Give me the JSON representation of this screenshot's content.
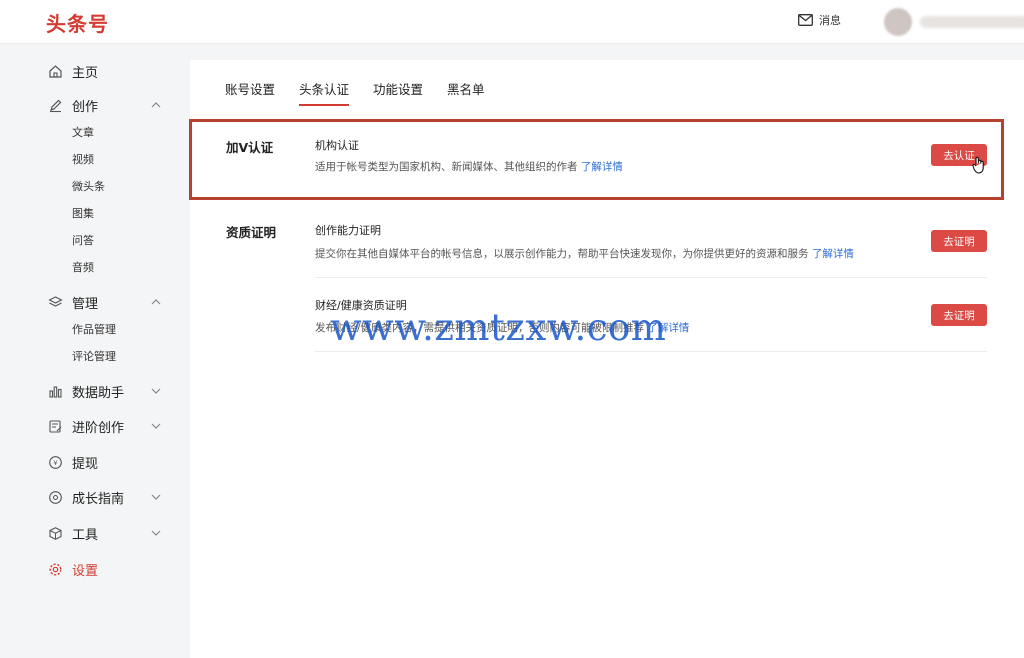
{
  "header": {
    "logo": "头条号",
    "messages_label": "消息"
  },
  "sidebar": {
    "items": [
      {
        "label": "主页",
        "icon": "home-icon"
      },
      {
        "label": "创作",
        "icon": "pen-icon"
      },
      {
        "label": "管理",
        "icon": "layers-icon"
      },
      {
        "label": "数据助手",
        "icon": "bar-chart-icon"
      },
      {
        "label": "进阶创作",
        "icon": "edit-doc-icon"
      },
      {
        "label": "提现",
        "icon": "coin-icon"
      },
      {
        "label": "成长指南",
        "icon": "growth-icon"
      },
      {
        "label": "工具",
        "icon": "box-icon"
      },
      {
        "label": "设置",
        "icon": "gear-icon"
      }
    ],
    "create_sub": [
      "文章",
      "视频",
      "微头条",
      "图集",
      "问答",
      "音频"
    ],
    "manage_sub": [
      "作品管理",
      "评论管理"
    ]
  },
  "tabs": [
    "账号设置",
    "头条认证",
    "功能设置",
    "黑名单"
  ],
  "sections": {
    "v_auth": {
      "title": "加V认证",
      "item_title": "机构认证",
      "desc": "适用于帐号类型为国家机构、新闻媒体、其他组织的作者",
      "link": "了解详情",
      "button": "去认证"
    },
    "qualification": {
      "title": "资质证明",
      "item1_title": "创作能力证明",
      "item1_desc": "提交你在其他自媒体平台的帐号信息，以展示创作能力，帮助平台快速发现你，为你提供更好的资源和服务",
      "item1_link": "了解详情",
      "item1_button": "去证明",
      "item2_title": "财经/健康资质证明",
      "item2_desc": "发布财经/健康类内容，需提供相关资质证明，否则内容可能被限制推荐",
      "item2_link": "了解详情",
      "item2_button": "去证明"
    }
  },
  "watermark": "www.zmtzxw.com",
  "colors": {
    "brand": "#d43c33",
    "button": "#dc4a46",
    "link": "#2f6fd6",
    "highlight": "#b5412e"
  }
}
